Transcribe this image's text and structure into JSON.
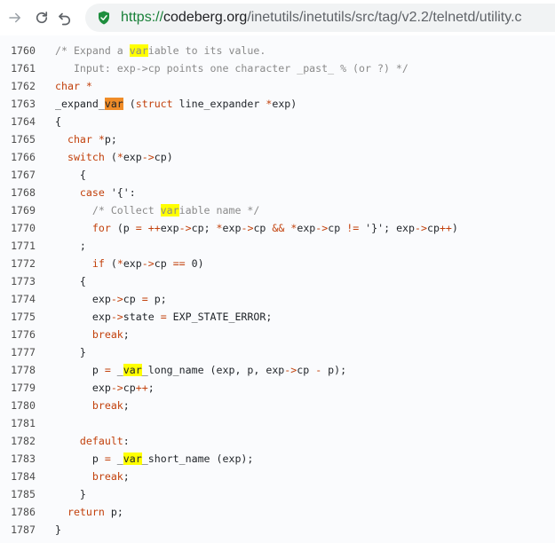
{
  "browser": {
    "url_scheme": "https://",
    "url_host": "codeberg.org",
    "url_path": "/inetutils/inetutils/src/tag/v2.2/telnetd/utility.c"
  },
  "code": {
    "lines": [
      {
        "n": "1760",
        "t": [
          [
            "cm",
            "/* Expand a "
          ],
          [
            "cm hl",
            "var"
          ],
          [
            "cm",
            "iable to its value."
          ]
        ]
      },
      {
        "n": "1761",
        "t": [
          [
            "cm",
            "   Input: exp->cp points one character _past_ % (or ?) */"
          ]
        ]
      },
      {
        "n": "1762",
        "t": [
          [
            "kw",
            "char"
          ],
          [
            "id",
            " "
          ],
          [
            "op",
            "*"
          ]
        ]
      },
      {
        "n": "1763",
        "t": [
          [
            "id",
            "_expand_"
          ],
          [
            "hl2",
            "var"
          ],
          [
            "id",
            " ("
          ],
          [
            "kw",
            "struct"
          ],
          [
            "id",
            " line_expander "
          ],
          [
            "op",
            "*"
          ],
          [
            "id",
            "exp)"
          ]
        ]
      },
      {
        "n": "1764",
        "t": [
          [
            "id",
            "{"
          ]
        ]
      },
      {
        "n": "1765",
        "t": [
          [
            "id",
            "  "
          ],
          [
            "kw",
            "char"
          ],
          [
            "id",
            " "
          ],
          [
            "op",
            "*"
          ],
          [
            "id",
            "p;"
          ]
        ]
      },
      {
        "n": "1766",
        "t": [
          [
            "id",
            "  "
          ],
          [
            "kw",
            "switch"
          ],
          [
            "id",
            " ("
          ],
          [
            "op",
            "*"
          ],
          [
            "id",
            "exp"
          ],
          [
            "op",
            "->"
          ],
          [
            "id",
            "cp)"
          ]
        ]
      },
      {
        "n": "1767",
        "t": [
          [
            "id",
            "    {"
          ]
        ]
      },
      {
        "n": "1768",
        "t": [
          [
            "id",
            "    "
          ],
          [
            "kw",
            "case"
          ],
          [
            "id",
            " '{':"
          ]
        ]
      },
      {
        "n": "1769",
        "t": [
          [
            "id",
            "      "
          ],
          [
            "cm",
            "/* Collect "
          ],
          [
            "cm hl",
            "var"
          ],
          [
            "cm",
            "iable name */"
          ]
        ]
      },
      {
        "n": "1770",
        "t": [
          [
            "id",
            "      "
          ],
          [
            "kw",
            "for"
          ],
          [
            "id",
            " (p "
          ],
          [
            "op",
            "="
          ],
          [
            "id",
            " "
          ],
          [
            "op",
            "++"
          ],
          [
            "id",
            "exp"
          ],
          [
            "op",
            "->"
          ],
          [
            "id",
            "cp; "
          ],
          [
            "op",
            "*"
          ],
          [
            "id",
            "exp"
          ],
          [
            "op",
            "->"
          ],
          [
            "id",
            "cp "
          ],
          [
            "op",
            "&&"
          ],
          [
            "id",
            " "
          ],
          [
            "op",
            "*"
          ],
          [
            "id",
            "exp"
          ],
          [
            "op",
            "->"
          ],
          [
            "id",
            "cp "
          ],
          [
            "op",
            "!="
          ],
          [
            "id",
            " '}'; exp"
          ],
          [
            "op",
            "->"
          ],
          [
            "id",
            "cp"
          ],
          [
            "op",
            "++"
          ],
          [
            "id",
            ")"
          ]
        ]
      },
      {
        "n": "1771",
        "t": [
          [
            "id",
            "    ;"
          ]
        ]
      },
      {
        "n": "1772",
        "t": [
          [
            "id",
            "      "
          ],
          [
            "kw",
            "if"
          ],
          [
            "id",
            " ("
          ],
          [
            "op",
            "*"
          ],
          [
            "id",
            "exp"
          ],
          [
            "op",
            "->"
          ],
          [
            "id",
            "cp "
          ],
          [
            "op",
            "=="
          ],
          [
            "id",
            " 0)"
          ]
        ]
      },
      {
        "n": "1773",
        "t": [
          [
            "id",
            "    {"
          ]
        ]
      },
      {
        "n": "1774",
        "t": [
          [
            "id",
            "      exp"
          ],
          [
            "op",
            "->"
          ],
          [
            "id",
            "cp "
          ],
          [
            "op",
            "="
          ],
          [
            "id",
            " p;"
          ]
        ]
      },
      {
        "n": "1775",
        "t": [
          [
            "id",
            "      exp"
          ],
          [
            "op",
            "->"
          ],
          [
            "id",
            "state "
          ],
          [
            "op",
            "="
          ],
          [
            "id",
            " EXP_STATE_ERROR;"
          ]
        ]
      },
      {
        "n": "1776",
        "t": [
          [
            "id",
            "      "
          ],
          [
            "kw",
            "break"
          ],
          [
            "id",
            ";"
          ]
        ]
      },
      {
        "n": "1777",
        "t": [
          [
            "id",
            "    }"
          ]
        ]
      },
      {
        "n": "1778",
        "t": [
          [
            "id",
            "      p "
          ],
          [
            "op",
            "="
          ],
          [
            "id",
            " _"
          ],
          [
            "hl",
            "var"
          ],
          [
            "id",
            "_long_name (exp, p, exp"
          ],
          [
            "op",
            "->"
          ],
          [
            "id",
            "cp "
          ],
          [
            "op",
            "-"
          ],
          [
            "id",
            " p);"
          ]
        ]
      },
      {
        "n": "1779",
        "t": [
          [
            "id",
            "      exp"
          ],
          [
            "op",
            "->"
          ],
          [
            "id",
            "cp"
          ],
          [
            "op",
            "++"
          ],
          [
            "id",
            ";"
          ]
        ]
      },
      {
        "n": "1780",
        "t": [
          [
            "id",
            "      "
          ],
          [
            "kw",
            "break"
          ],
          [
            "id",
            ";"
          ]
        ]
      },
      {
        "n": "1781",
        "t": [
          [
            "id",
            ""
          ]
        ]
      },
      {
        "n": "1782",
        "t": [
          [
            "id",
            "    "
          ],
          [
            "kw",
            "default"
          ],
          [
            "id",
            ":"
          ]
        ]
      },
      {
        "n": "1783",
        "t": [
          [
            "id",
            "      p "
          ],
          [
            "op",
            "="
          ],
          [
            "id",
            " _"
          ],
          [
            "hl",
            "var"
          ],
          [
            "id",
            "_short_name (exp);"
          ]
        ]
      },
      {
        "n": "1784",
        "t": [
          [
            "id",
            "      "
          ],
          [
            "kw",
            "break"
          ],
          [
            "id",
            ";"
          ]
        ]
      },
      {
        "n": "1785",
        "t": [
          [
            "id",
            "    }"
          ]
        ]
      },
      {
        "n": "1786",
        "t": [
          [
            "id",
            "  "
          ],
          [
            "kw",
            "return"
          ],
          [
            "id",
            " p;"
          ]
        ]
      },
      {
        "n": "1787",
        "t": [
          [
            "id",
            "}"
          ]
        ]
      }
    ]
  }
}
